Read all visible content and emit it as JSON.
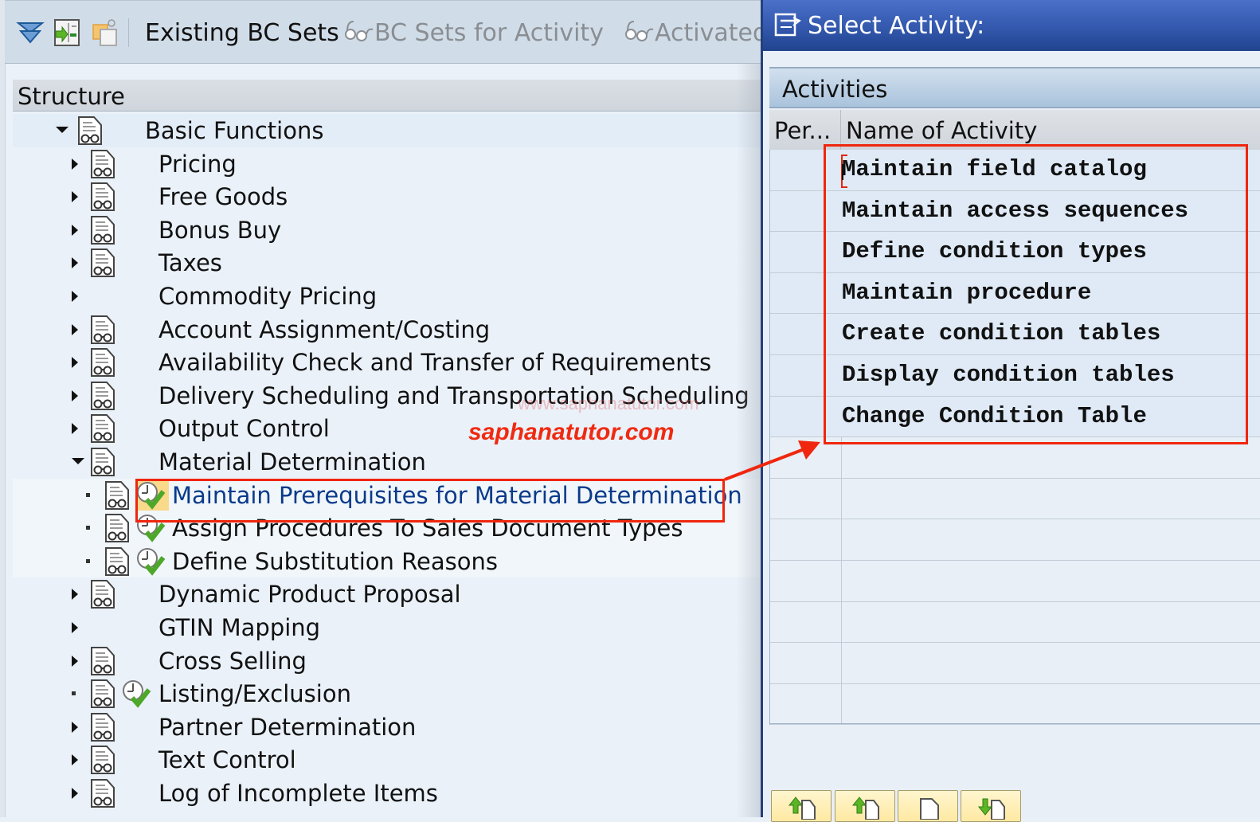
{
  "toolbar": {
    "icons": [
      "expand-subtree-icon",
      "execute-icon",
      "copy-icon"
    ],
    "buttons": [
      {
        "label": "Existing BC Sets",
        "state": "enabled",
        "icon": ""
      },
      {
        "label": "BC Sets for Activity",
        "state": "disabled",
        "icon": "glasses-icon"
      },
      {
        "label": "Activated",
        "state": "disabled",
        "icon": "glasses-icon"
      }
    ]
  },
  "structure": {
    "header": "Structure",
    "items": [
      {
        "label": "Basic Functions",
        "level": 0,
        "expander": "expanded",
        "has_doc": true,
        "has_clock": false
      },
      {
        "label": "Pricing",
        "level": 1,
        "expander": "collapsed",
        "has_doc": true,
        "has_clock": false
      },
      {
        "label": "Free Goods",
        "level": 1,
        "expander": "collapsed",
        "has_doc": true,
        "has_clock": false
      },
      {
        "label": "Bonus Buy",
        "level": 1,
        "expander": "collapsed",
        "has_doc": true,
        "has_clock": false
      },
      {
        "label": "Taxes",
        "level": 1,
        "expander": "collapsed",
        "has_doc": true,
        "has_clock": false
      },
      {
        "label": "Commodity Pricing",
        "level": 1,
        "expander": "collapsed",
        "has_doc": false,
        "has_clock": false
      },
      {
        "label": "Account Assignment/Costing",
        "level": 1,
        "expander": "collapsed",
        "has_doc": true,
        "has_clock": false
      },
      {
        "label": "Availability Check and Transfer of Requirements",
        "level": 1,
        "expander": "collapsed",
        "has_doc": true,
        "has_clock": false
      },
      {
        "label": "Delivery Scheduling and Transportation Scheduling",
        "level": 1,
        "expander": "collapsed",
        "has_doc": true,
        "has_clock": false
      },
      {
        "label": "Output Control",
        "level": 1,
        "expander": "collapsed",
        "has_doc": true,
        "has_clock": false
      },
      {
        "label": "Material Determination",
        "level": 1,
        "expander": "expanded",
        "has_doc": true,
        "has_clock": false
      },
      {
        "label": "Maintain Prerequisites for Material Determination",
        "level": 2,
        "expander": "leaf",
        "has_doc": true,
        "has_clock": true,
        "selected": true
      },
      {
        "label": "Assign Procedures To Sales Document Types",
        "level": 2,
        "expander": "leaf",
        "has_doc": true,
        "has_clock": true
      },
      {
        "label": "Define Substitution Reasons",
        "level": 2,
        "expander": "leaf",
        "has_doc": true,
        "has_clock": true
      },
      {
        "label": "Dynamic Product Proposal",
        "level": 1,
        "expander": "collapsed",
        "has_doc": true,
        "has_clock": false
      },
      {
        "label": "GTIN Mapping",
        "level": 1,
        "expander": "collapsed",
        "has_doc": false,
        "has_clock": false
      },
      {
        "label": "Cross Selling",
        "level": 1,
        "expander": "collapsed",
        "has_doc": true,
        "has_clock": false
      },
      {
        "label": "Listing/Exclusion",
        "level": 1,
        "expander": "leaf",
        "has_doc": true,
        "has_clock": true
      },
      {
        "label": "Partner Determination",
        "level": 1,
        "expander": "collapsed",
        "has_doc": true,
        "has_clock": false
      },
      {
        "label": "Text Control",
        "level": 1,
        "expander": "collapsed",
        "has_doc": true,
        "has_clock": false
      },
      {
        "label": "Log of Incomplete Items",
        "level": 1,
        "expander": "collapsed",
        "has_doc": true,
        "has_clock": false
      }
    ]
  },
  "annotations": {
    "watermark": "www.saphanatutor.com",
    "brand": "saphanatutor.com",
    "highlight_color": "#f0260e"
  },
  "dialog": {
    "title": "Select Activity:",
    "group_header": "Activities",
    "columns": [
      "Per...",
      "Name of Activity"
    ],
    "activities": [
      "Maintain field catalog",
      "Maintain access sequences",
      "Define condition types",
      "Maintain procedure",
      "Create condition tables",
      "Display condition tables",
      "Change Condition Table"
    ],
    "empty_rows": 7,
    "buttons": [
      "move-up-icon",
      "move-up-page-icon",
      "page-icon",
      "move-down-icon"
    ]
  }
}
